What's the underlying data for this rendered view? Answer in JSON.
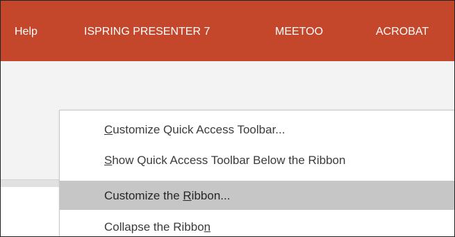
{
  "ribbon_tabs": [
    {
      "label": "Help"
    },
    {
      "label": "ISPRING PRESENTER 7"
    },
    {
      "label": "MEETOO"
    },
    {
      "label": "ACROBAT"
    }
  ],
  "context_menu": {
    "items": [
      {
        "label": "Customize Quick Access Toolbar...",
        "pre": "",
        "key": "C",
        "post": "ustomize Quick Access Toolbar..."
      },
      {
        "label": "Show Quick Access Toolbar Below the Ribbon",
        "pre": "",
        "key": "S",
        "post": "how Quick Access Toolbar Below the Ribbon"
      },
      {
        "label": "Customize the Ribbon...",
        "pre": "Customize the ",
        "key": "R",
        "post": "ibbon...",
        "highlighted": true
      },
      {
        "label": "Collapse the Ribbon",
        "pre": "Collapse the Ribbo",
        "key": "n",
        "post": ""
      }
    ]
  },
  "colors": {
    "tab_bar": "#c4472b",
    "ribbon": "#f3f3f3",
    "menu_highlight": "#c6c6c6"
  }
}
